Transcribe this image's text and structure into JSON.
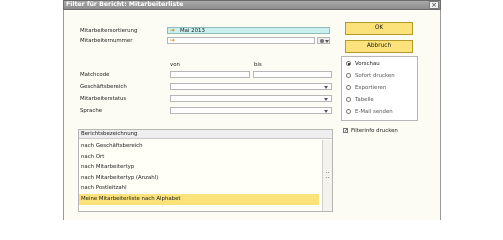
{
  "window": {
    "title": "Filter für Bericht: Mitarbeiterliste"
  },
  "form": {
    "sort_label": "Mitarbeitersortierung",
    "sort_value": "Mai 2013",
    "number_label": "Mitarbeiternummer",
    "from_label": "von",
    "to_label": "bis",
    "matchcode_label": "Matchcode",
    "business_area_label": "Geschäftsbereich",
    "status_label": "Mitarbeiterstatus",
    "language_label": "Sprache"
  },
  "buttons": {
    "ok_label": "OK",
    "cancel_label": "Abbruch"
  },
  "output": {
    "options": [
      "Vorschau",
      "Sofort drucken",
      "Exportieren",
      "Tabelle",
      "E-Mail senden"
    ],
    "selected": "Vorschau",
    "filterinfo_label": "Filterinfo drucken",
    "filterinfo_checked": true
  },
  "report_list": {
    "header": "Berichtsbezeichnung",
    "items": [
      "nach Geschäftsbereich",
      "nach Ort",
      "nach Mitarbeitertyp",
      "nach Mitarbeitertyp (Anzahl)",
      "nach Postleitzahl",
      "Meine Mitarbeiterliste nach Alphabet"
    ],
    "selected": "Meine Mitarbeiterliste nach Alphabet"
  },
  "icons": {
    "close": "close-icon",
    "row_indicator": "arrow-right-icon",
    "dropdown": "chevron-down-icon",
    "lookup": "lookup-icon"
  },
  "colors": {
    "highlight_field": "#c9efef",
    "button": "#fbe27a",
    "selected_row": "#fbe27a",
    "titlebar": "#9a9a9a"
  }
}
